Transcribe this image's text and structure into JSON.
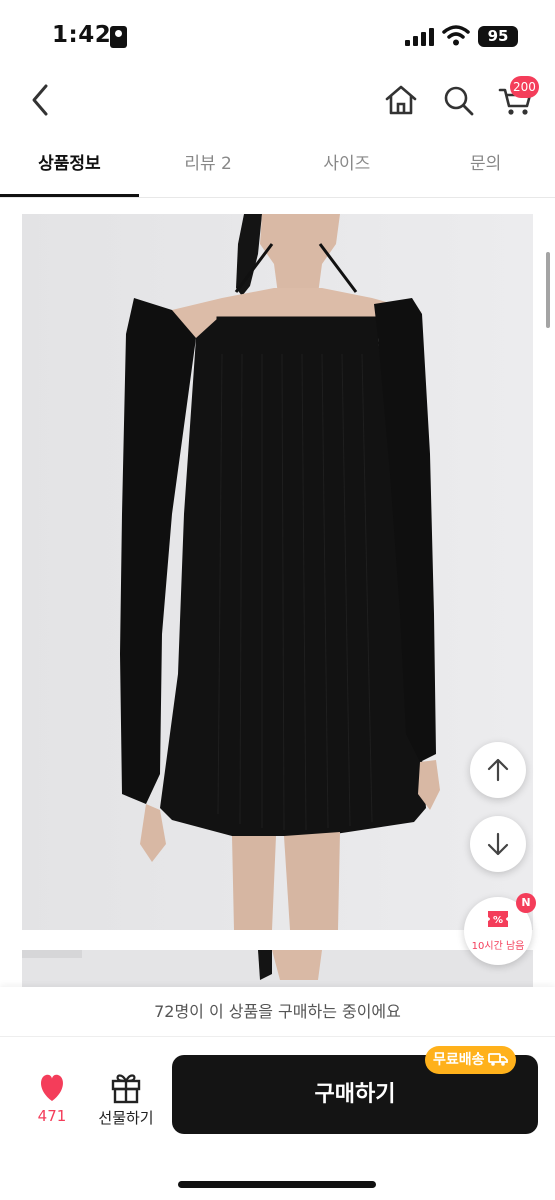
{
  "status_bar": {
    "time": "1:42",
    "battery": "95"
  },
  "header": {
    "cart_badge": "200"
  },
  "tabs": [
    {
      "label": "상품정보",
      "active": true
    },
    {
      "label": "리뷰 2",
      "active": false
    },
    {
      "label": "사이즈",
      "active": false
    },
    {
      "label": "문의",
      "active": false
    }
  ],
  "coupon": {
    "label": "10시간 남음",
    "badge": "N",
    "icon_text": "%"
  },
  "bottom_bar": {
    "notice": "72명이 이 상품을 구매하는 중이에요",
    "like_count": "471",
    "gift_label": "선물하기",
    "buy_label": "구매하기",
    "shipping_badge": "무료배송"
  },
  "colors": {
    "accent": "#f43d5a",
    "shipping": "#ffb11b",
    "buy_button": "#141414"
  }
}
